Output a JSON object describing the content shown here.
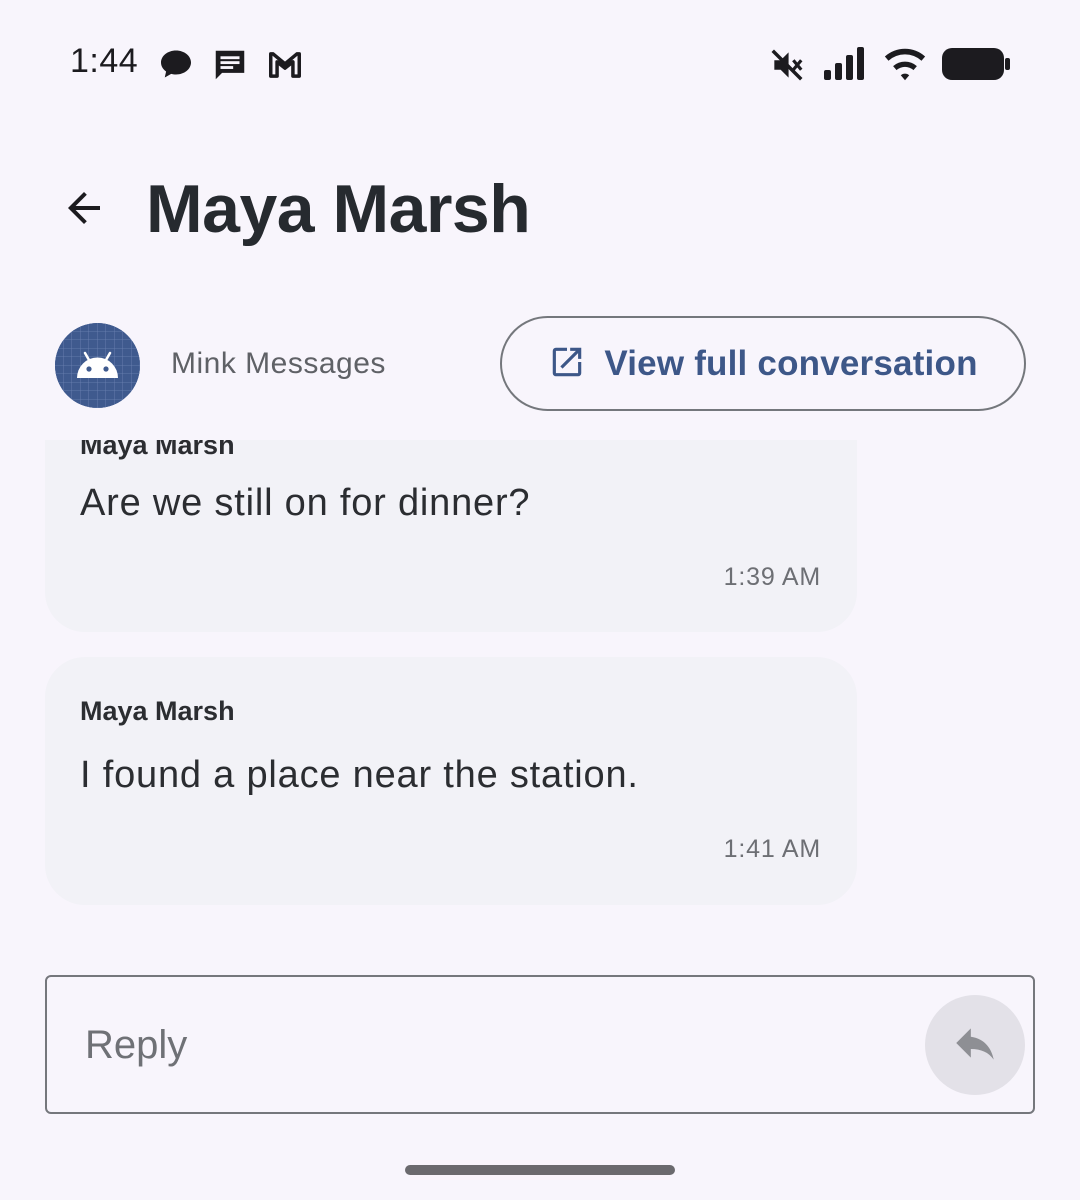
{
  "status_bar": {
    "time": "1:44",
    "left_icons": [
      "chat-bubble-icon",
      "message-icon",
      "gmail-icon"
    ],
    "right_icons": [
      "mute-icon",
      "cell-signal-icon",
      "wifi-icon",
      "battery-icon"
    ]
  },
  "header": {
    "title": "Maya Marsh",
    "back_icon": "arrow-back-icon"
  },
  "app_row": {
    "app_name": "Mink Messages",
    "view_button_label": "View full conversation",
    "view_button_icon": "open-in-new-icon"
  },
  "messages": [
    {
      "sender": "Maya Marsh",
      "text": "Are we still on for dinner?",
      "time": "1:39 AM"
    },
    {
      "sender": "Maya Marsh",
      "text": "I found a place near the station.",
      "time": "1:41 AM"
    }
  ],
  "reply": {
    "placeholder": "Reply",
    "value": "",
    "send_icon": "reply-icon"
  },
  "colors": {
    "background": "#f8f5fc",
    "bubble": "#f2f2f7",
    "accent": "#3d5788",
    "avatar": "#3f5a8e"
  }
}
